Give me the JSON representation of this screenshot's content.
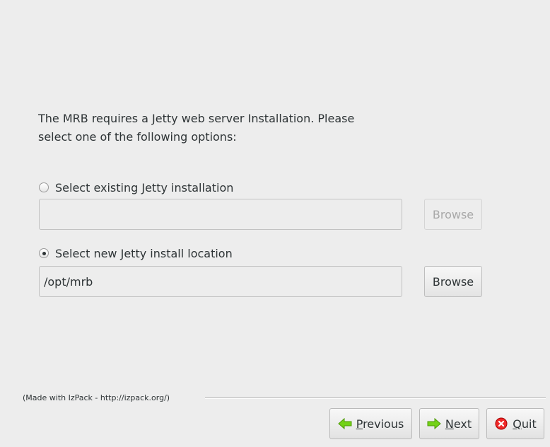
{
  "intro": {
    "line1": "The MRB requires a Jetty web server Installation. Please",
    "line2": "select one of the following options:"
  },
  "options": [
    {
      "label": "Select existing Jetty installation",
      "checked": false,
      "value": "",
      "browse_label": "Browse",
      "browse_enabled": false
    },
    {
      "label": "Select new Jetty install location",
      "checked": true,
      "value": "/opt/mrb",
      "browse_label": "Browse",
      "browse_enabled": true
    }
  ],
  "footer": {
    "made_with": "(Made with IzPack - http://izpack.org/)"
  },
  "nav": {
    "previous": {
      "mnemonic": "P",
      "rest": "revious",
      "icon": "arrow-left-icon"
    },
    "next": {
      "mnemonic": "N",
      "rest": "ext",
      "icon": "arrow-right-icon"
    },
    "quit": {
      "mnemonic": "Q",
      "rest": "uit",
      "icon": "close-circle-icon"
    }
  },
  "colors": {
    "arrow_green": "#4e9a06",
    "quit_red": "#cc0000"
  }
}
